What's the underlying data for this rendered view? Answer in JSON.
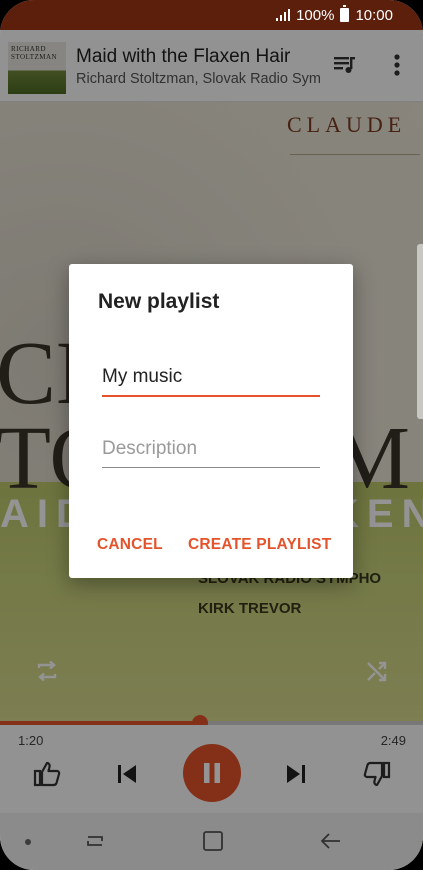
{
  "status_bar": {
    "battery": "100%",
    "time": "10:00"
  },
  "now_playing": {
    "title": "Maid with the Flaxen Hair",
    "artist": "Richard Stoltzman, Slovak Radio Sym..",
    "thumb_text_1": "RICHARD",
    "thumb_text_2": "STOLTZMAN"
  },
  "album_art": {
    "composer": "CLAUDE",
    "big_1": "CH",
    "big_2": "TO",
    "big_3": "M",
    "band_left": "AID",
    "band_right": "KEN",
    "orchestra": "SLOVAK RADIO SYMPHO",
    "conductor": "KIRK TREVOR"
  },
  "player": {
    "elapsed": "1:20",
    "total": "2:49",
    "progress": 0.4734
  },
  "dialog": {
    "title": "New playlist",
    "name_value": "My music",
    "description_placeholder": "Description",
    "cancel_label": "CANCEL",
    "create_label": "CREATE PLAYLIST"
  },
  "colors": {
    "accent": "#e4532b",
    "status_bar": "#5b1f0c"
  },
  "icons": [
    "signal-icon",
    "battery-icon",
    "queue-icon",
    "more-vert-icon",
    "repeat-icon",
    "shuffle-icon",
    "thumbs-up-icon",
    "skip-previous-icon",
    "pause-icon",
    "skip-next-icon",
    "thumbs-down-icon",
    "recents-icon",
    "home-icon",
    "back-icon"
  ]
}
